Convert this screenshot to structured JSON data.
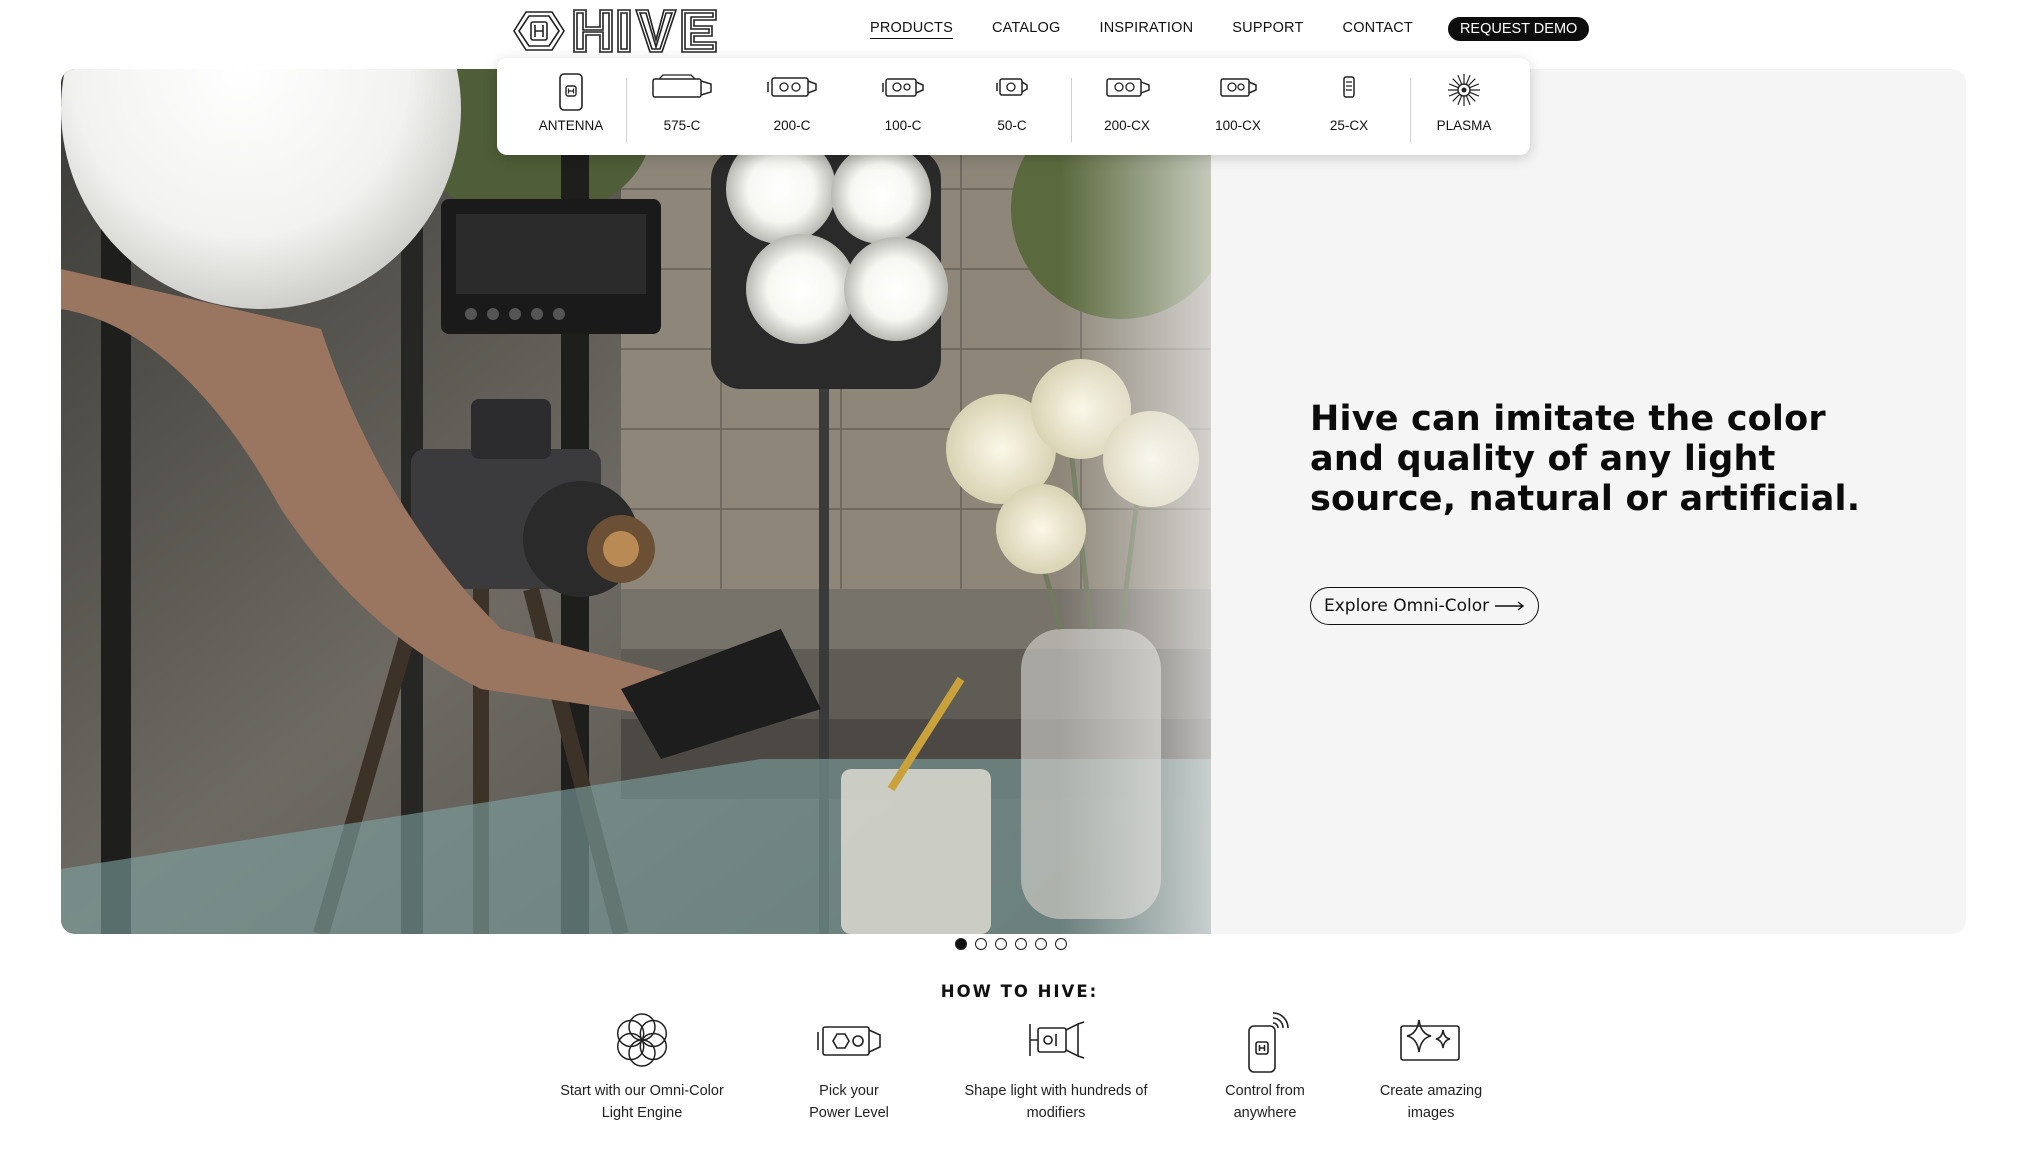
{
  "brand": {
    "name": "HIVE"
  },
  "nav": {
    "items": [
      {
        "label": "PRODUCTS"
      },
      {
        "label": "CATALOG"
      },
      {
        "label": "INSPIRATION"
      },
      {
        "label": "SUPPORT"
      },
      {
        "label": "CONTACT"
      }
    ],
    "demo_label": "REQUEST DEMO"
  },
  "products_menu": {
    "items": [
      {
        "label": "ANTENNA",
        "icon": "antenna-icon"
      },
      {
        "label": "575-C",
        "icon": "light-575c-icon"
      },
      {
        "label": "200-C",
        "icon": "light-200c-icon"
      },
      {
        "label": "100-C",
        "icon": "light-100c-icon"
      },
      {
        "label": "50-C",
        "icon": "light-50c-icon"
      },
      {
        "label": "200-CX",
        "icon": "light-200cx-icon"
      },
      {
        "label": "100-CX",
        "icon": "light-100cx-icon"
      },
      {
        "label": "25-CX",
        "icon": "light-25cx-icon"
      },
      {
        "label": "PLASMA",
        "icon": "plasma-burst-icon"
      }
    ]
  },
  "hero": {
    "headline": "Hive can imitate the color and quality of any light source, natural or artificial.",
    "cta_label": "Explore Omni-Color"
  },
  "carousel": {
    "slide_count": 6,
    "active_index": 0
  },
  "how_to": {
    "title": "HOW TO HIVE:",
    "steps": [
      {
        "label": "Start with our Omni-Color Light Engine",
        "icon": "flower-engine-icon"
      },
      {
        "label": "Pick your Power Level",
        "icon": "light-fixture-icon"
      },
      {
        "label": "Shape light with hundreds of modifiers",
        "icon": "modifier-icon"
      },
      {
        "label": "Control from anywhere",
        "icon": "phone-remote-icon"
      },
      {
        "label": "Create amazing images",
        "icon": "sparkle-image-icon"
      }
    ]
  },
  "colors": {
    "text": "#111111",
    "hero_bg": "#f5f5f5",
    "button_dark": "#0d0d0d"
  }
}
